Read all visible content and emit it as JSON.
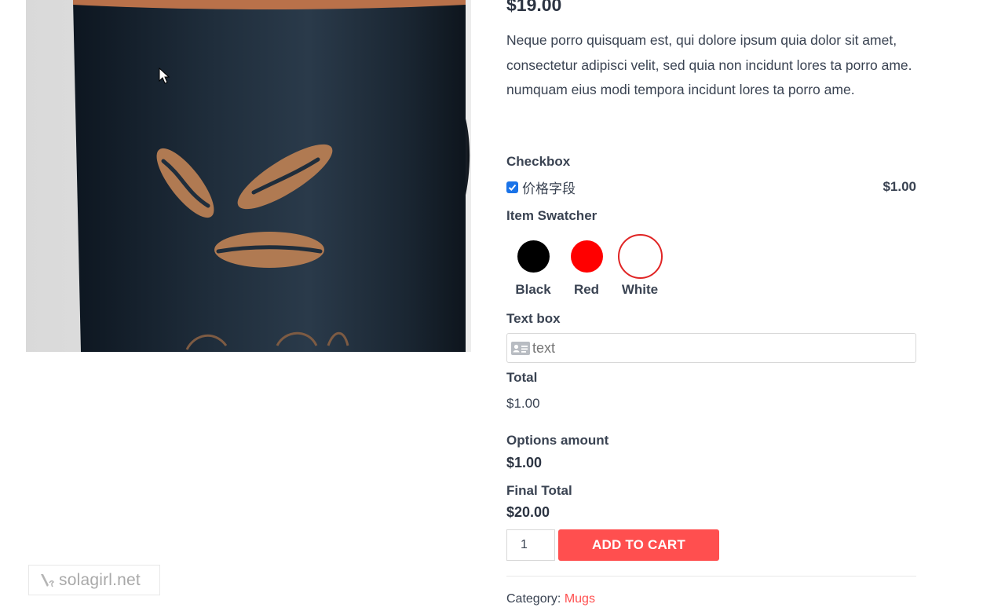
{
  "product": {
    "price": "$19.00",
    "description": "Neque porro quisquam est, qui dolore ipsum quia dolor sit amet, consectetur adipisci velit, sed quia non incidunt lores ta porro ame. numquam eius modi tempora incidunt lores ta porro ame.",
    "image_icon": "coffee-mug-with-bean-logo"
  },
  "options": {
    "checkbox": {
      "label": "Checkbox",
      "item_label": "价格字段",
      "item_price": "$1.00",
      "checked": true
    },
    "swatcher": {
      "label": "Item Swatcher",
      "items": [
        {
          "name": "Black",
          "color": "#000000",
          "selected": false
        },
        {
          "name": "Red",
          "color": "#ff0000",
          "selected": false
        },
        {
          "name": "White",
          "color": "#ffffff",
          "selected": true
        }
      ]
    },
    "textbox": {
      "label": "Text box",
      "placeholder": "text",
      "icon": "id-card-icon"
    }
  },
  "totals": {
    "total_label": "Total",
    "total_value": "$1.00",
    "options_amount_label": "Options amount",
    "options_amount_value": "$1.00",
    "final_total_label": "Final Total",
    "final_total_value": "$20.00"
  },
  "cart": {
    "quantity": "1",
    "button_label": "ADD TO CART"
  },
  "meta": {
    "category_label": "Category: ",
    "category_value": "Mugs"
  },
  "watermark": {
    "text": "solagirl.net"
  },
  "colors": {
    "accent": "#ff4f4f",
    "text": "#3a4352",
    "checkbox": "#1a73e8",
    "swatch_selected_ring": "#e02424"
  }
}
